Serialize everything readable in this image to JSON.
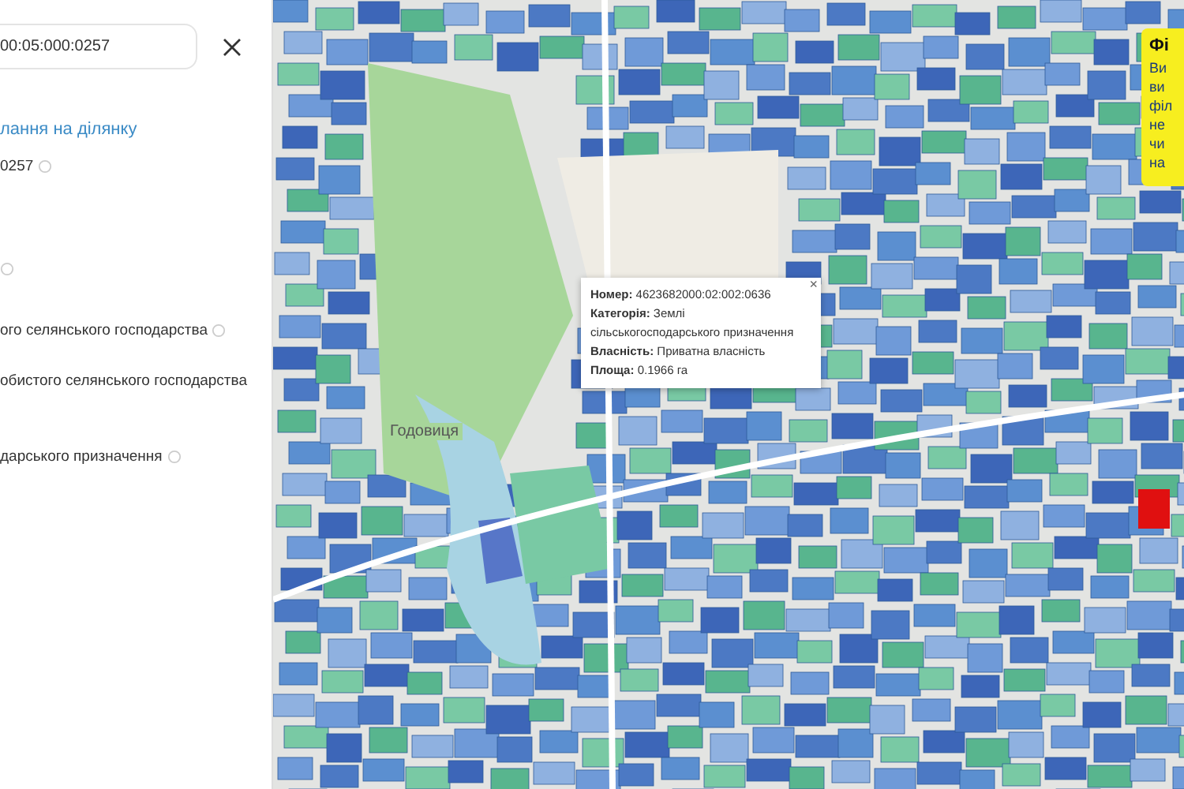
{
  "panel": {
    "search": {
      "value": "00:05:000:0257"
    },
    "link": "лання на ділянку",
    "rows": [
      {
        "text": "0257",
        "info": true
      },
      {
        "text": "",
        "info": true
      },
      {
        "text": "ого селянського господарства",
        "info": true
      },
      {
        "text": "обистого селянського господарства",
        "info": false
      },
      {
        "text": "дарського призначення",
        "info": true
      }
    ]
  },
  "map": {
    "place_label": "Годовиця",
    "popup": {
      "close": "×",
      "fields": [
        {
          "label": "Номер:",
          "value": "4623682000:02:002:0636"
        },
        {
          "label": "Категорія:",
          "value": "Землі сільськогосподарського призначення"
        },
        {
          "label": "Власність:",
          "value": "Приватна власність"
        },
        {
          "label": "Площа:",
          "value": "0.1966 га"
        }
      ]
    },
    "notice": {
      "title": "Фі",
      "lines": [
        "Ви",
        "ви",
        "філ",
        "не",
        "чи",
        "на"
      ]
    }
  }
}
